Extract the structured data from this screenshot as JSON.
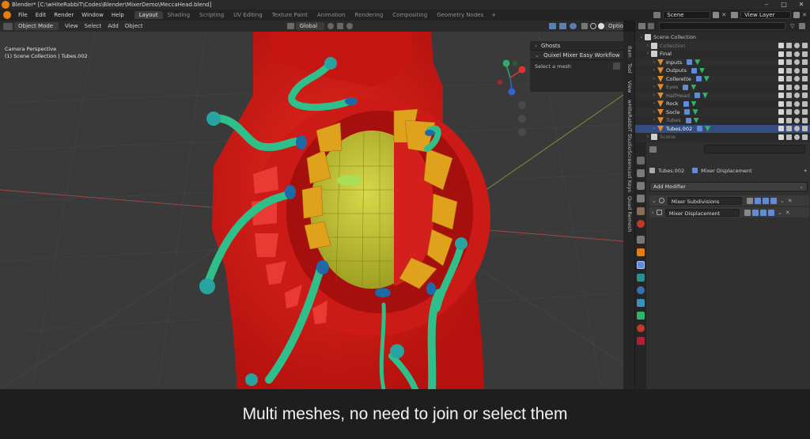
{
  "window": {
    "title": "Blender* [C:\\wHiteRabbiT\\Codes\\Blender\\MixerDemo\\MeccaHead.blend]"
  },
  "menu": [
    "File",
    "Edit",
    "Render",
    "Window",
    "Help"
  ],
  "workspaces": {
    "tabs": [
      "Layout",
      "Shading",
      "Scripting",
      "UV Editing",
      "Texture Paint",
      "Animation",
      "Rendering",
      "Compositing",
      "Geometry Nodes"
    ],
    "active": "Layout",
    "add": "+"
  },
  "topright": {
    "scene": "Scene",
    "view_layer": "View Layer"
  },
  "viewport": {
    "mode": "Object Mode",
    "menus": [
      "View",
      "Select",
      "Add",
      "Object"
    ],
    "orientation": "Global",
    "options": "Options",
    "camera_label": "Camera Perspective",
    "collection_label": "(1) Scene Collection | Tubes.002"
  },
  "npanel": {
    "ghosts": "Ghosts",
    "panel_title": "Quixel Mixer Easy Workflow",
    "select_text": "Select a mesh"
  },
  "side_tabs": [
    "Item",
    "Tool",
    "View",
    "wHiteRabbiT Studio",
    "Screencast Keys",
    "Quad Remesh"
  ],
  "outliner": {
    "search_placeholder": "",
    "rows": [
      {
        "label": "Scene Collection",
        "indent": 0,
        "color": "#bfbfbf",
        "type": "collection"
      },
      {
        "label": "Collection",
        "indent": 1,
        "color": "#7a7a7a",
        "type": "collection"
      },
      {
        "label": "Final",
        "indent": 1,
        "color": "#dedede",
        "type": "collection"
      },
      {
        "label": "Inputs",
        "indent": 2,
        "color": "#dedede",
        "type": "object"
      },
      {
        "label": "Outputs",
        "indent": 2,
        "color": "#dedede",
        "type": "object"
      },
      {
        "label": "Collerette",
        "indent": 2,
        "color": "#dedede",
        "type": "object"
      },
      {
        "label": "Eyes",
        "indent": 2,
        "color": "#8a8a8a",
        "type": "object"
      },
      {
        "label": "HalfHead",
        "indent": 2,
        "color": "#8a8a8a",
        "type": "object"
      },
      {
        "label": "Rock",
        "indent": 2,
        "color": "#dedede",
        "type": "object"
      },
      {
        "label": "Socle",
        "indent": 2,
        "color": "#dedede",
        "type": "object"
      },
      {
        "label": "Tubes",
        "indent": 2,
        "color": "#8a8a8a",
        "type": "object"
      },
      {
        "label": "Tubes.002",
        "indent": 2,
        "color": "#ffffff",
        "type": "object",
        "selected": true
      },
      {
        "label": "Scene",
        "indent": 1,
        "color": "#7a7a7a",
        "type": "collection"
      }
    ]
  },
  "properties": {
    "object_name": "Tubes.002",
    "modifier_name": "Mixer Displacement",
    "add_modifier": "Add Modifier",
    "modifiers": [
      "Mixer Subdivisions",
      "Mixer Displacement"
    ]
  },
  "caption": "Multi meshes, no need to join or select them",
  "colors": {
    "accent": "#e87d0d",
    "selected_row": "#334d80",
    "mesh_red": "#d71a17",
    "mesh_yellow": "#c8c832",
    "tube_green": "#2fbf8a",
    "gold": "#e0a21c"
  }
}
